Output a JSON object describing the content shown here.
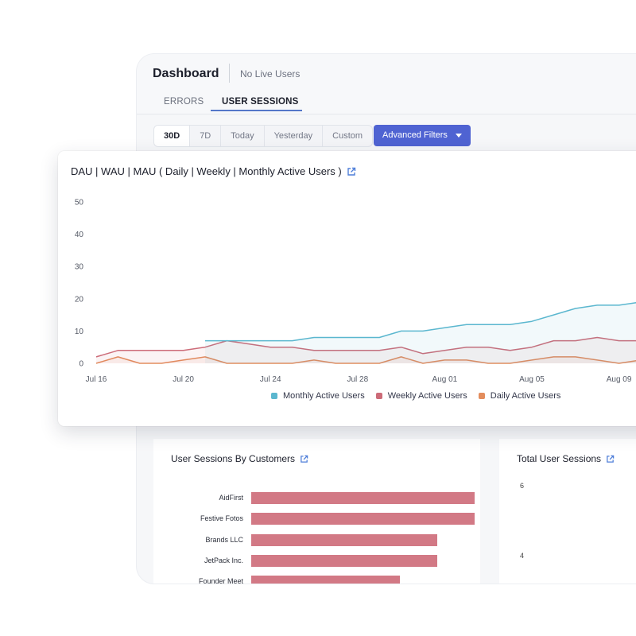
{
  "header": {
    "title": "Dashboard",
    "live_users": "No Live Users"
  },
  "tabs": [
    {
      "label": "ERRORS",
      "active": false
    },
    {
      "label": "USER SESSIONS",
      "active": true
    }
  ],
  "range": {
    "buttons": [
      "30D",
      "7D",
      "Today",
      "Yesterday",
      "Custom"
    ],
    "selected": "30D"
  },
  "filters": {
    "label": "Advanced Filters"
  },
  "colors": {
    "accent": "#4f63d2",
    "mau": "#5bb7cf",
    "wau": "#cc6b78",
    "dau": "#e38d5d",
    "bar": "#d27985"
  },
  "active_users_card": {
    "title": "DAU | WAU | MAU ( Daily | Weekly | Monthly Active Users )",
    "icon": "external-link-icon"
  },
  "chart_data": [
    {
      "type": "line",
      "title": "DAU | WAU | MAU ( Daily | Weekly | Monthly Active Users )",
      "y_ticks": [
        "0",
        "10",
        "20",
        "30",
        "40",
        "50"
      ],
      "ylim": [
        0,
        50
      ],
      "x_ticks": [
        "Jul 16",
        "Jul 20",
        "Jul 24",
        "Jul 28",
        "Aug 01",
        "Aug 05",
        "Aug 09"
      ],
      "x": [
        0,
        1,
        2,
        3,
        4,
        5,
        6,
        7,
        8,
        9,
        10,
        11,
        12,
        13,
        14,
        15,
        16,
        17,
        18,
        19,
        20,
        21,
        22,
        23,
        24,
        25,
        26
      ],
      "grid": false,
      "legend": "bottom",
      "series": [
        {
          "name": "Monthly Active Users",
          "color": "#5bb7cf",
          "start": 5,
          "values": [
            7,
            7,
            7,
            7,
            7,
            8,
            8,
            8,
            8,
            10,
            10,
            11,
            12,
            12,
            12,
            13,
            15,
            17,
            18,
            18,
            19,
            20,
            20
          ]
        },
        {
          "name": "Weekly Active Users",
          "color": "#cc6b78",
          "start": 0,
          "values": [
            2,
            4,
            4,
            4,
            4,
            5,
            7,
            6,
            5,
            5,
            4,
            4,
            4,
            4,
            5,
            3,
            4,
            5,
            5,
            4,
            5,
            7,
            7,
            8,
            7,
            7,
            8,
            8
          ]
        },
        {
          "name": "Daily Active Users",
          "color": "#e38d5d",
          "start": 0,
          "values": [
            0,
            2,
            0,
            0,
            1,
            2,
            0,
            0,
            0,
            0,
            1,
            0,
            0,
            0,
            2,
            0,
            1,
            1,
            0,
            0,
            1,
            2,
            2,
            1,
            0,
            1,
            1,
            0
          ]
        }
      ]
    },
    {
      "type": "bar",
      "orientation": "horizontal",
      "title": "User Sessions By Customers",
      "categories": [
        "AidFirst",
        "Festive Fotos",
        "Brands LLC",
        "JetPack Inc.",
        "Founder Meet"
      ],
      "values": [
        6,
        6,
        5,
        5,
        4
      ]
    },
    {
      "type": "line",
      "title": "Total User Sessions",
      "y_ticks": [
        "6",
        "4"
      ]
    }
  ],
  "customers_card": {
    "title": "User Sessions By Customers"
  },
  "total_card": {
    "title": "Total User Sessions"
  }
}
